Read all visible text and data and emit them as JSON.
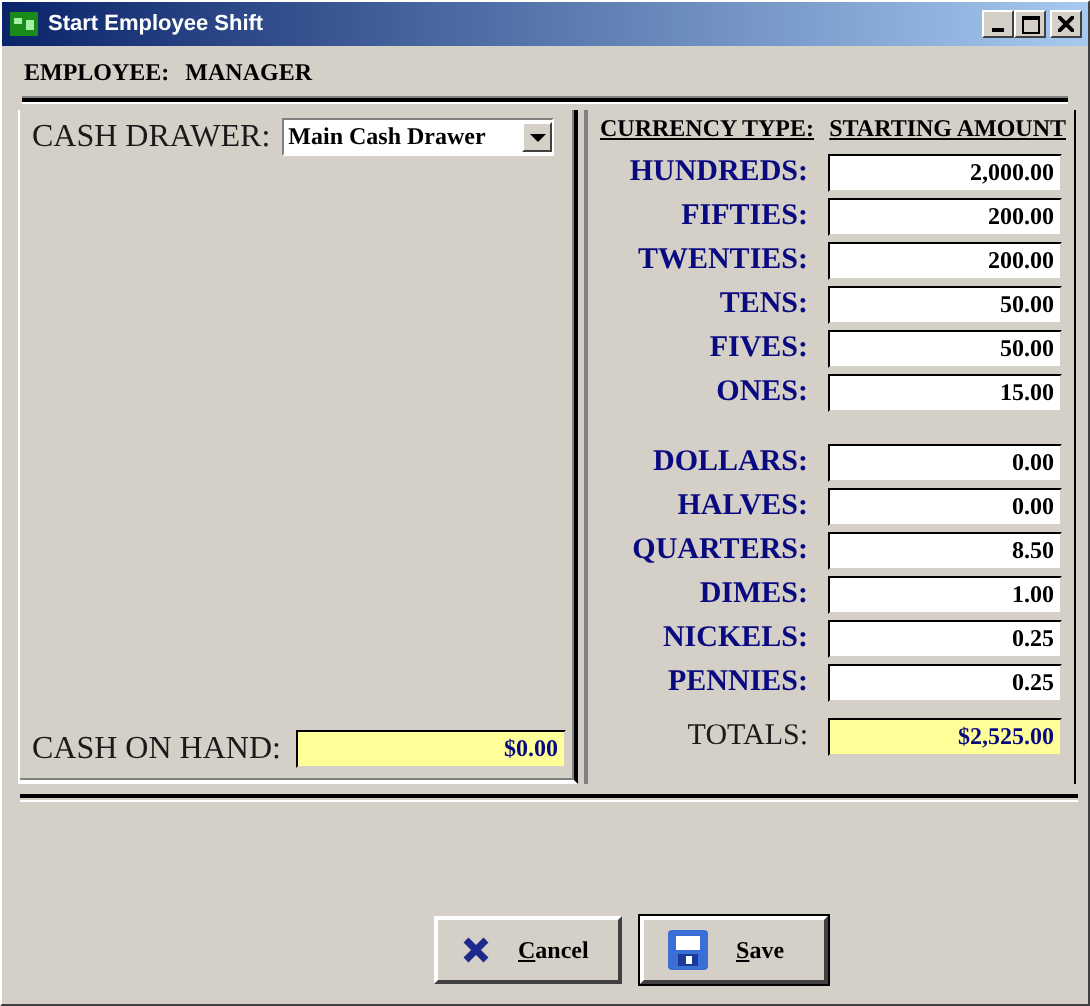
{
  "window": {
    "title": "Start Employee Shift"
  },
  "employee": {
    "label": "EMPLOYEE:",
    "value": "MANAGER"
  },
  "cash_drawer": {
    "label": "CASH DRAWER:",
    "value": "Main Cash Drawer"
  },
  "cash_on_hand": {
    "label": "CASH ON HAND:",
    "value": "$0.00"
  },
  "columns": [
    "CURRENCY TYPE:",
    "STARTING AMOUNT"
  ],
  "bills": [
    {
      "label": "HUNDREDS:",
      "value": "2,000.00"
    },
    {
      "label": "FIFTIES:",
      "value": "200.00"
    },
    {
      "label": "TWENTIES:",
      "value": "200.00"
    },
    {
      "label": "TENS:",
      "value": "50.00"
    },
    {
      "label": "FIVES:",
      "value": "50.00"
    },
    {
      "label": "ONES:",
      "value": "15.00"
    }
  ],
  "coins": [
    {
      "label": "DOLLARS:",
      "value": "0.00"
    },
    {
      "label": "HALVES:",
      "value": "0.00"
    },
    {
      "label": "QUARTERS:",
      "value": "8.50"
    },
    {
      "label": "DIMES:",
      "value": "1.00"
    },
    {
      "label": "NICKELS:",
      "value": "0.25"
    },
    {
      "label": "PENNIES:",
      "value": "0.25"
    }
  ],
  "totals": {
    "label": "TOTALS:",
    "value": "$2,525.00"
  },
  "buttons": [
    {
      "label": "Cancel",
      "kind": "cancel"
    },
    {
      "label": "Save",
      "kind": "save"
    }
  ]
}
